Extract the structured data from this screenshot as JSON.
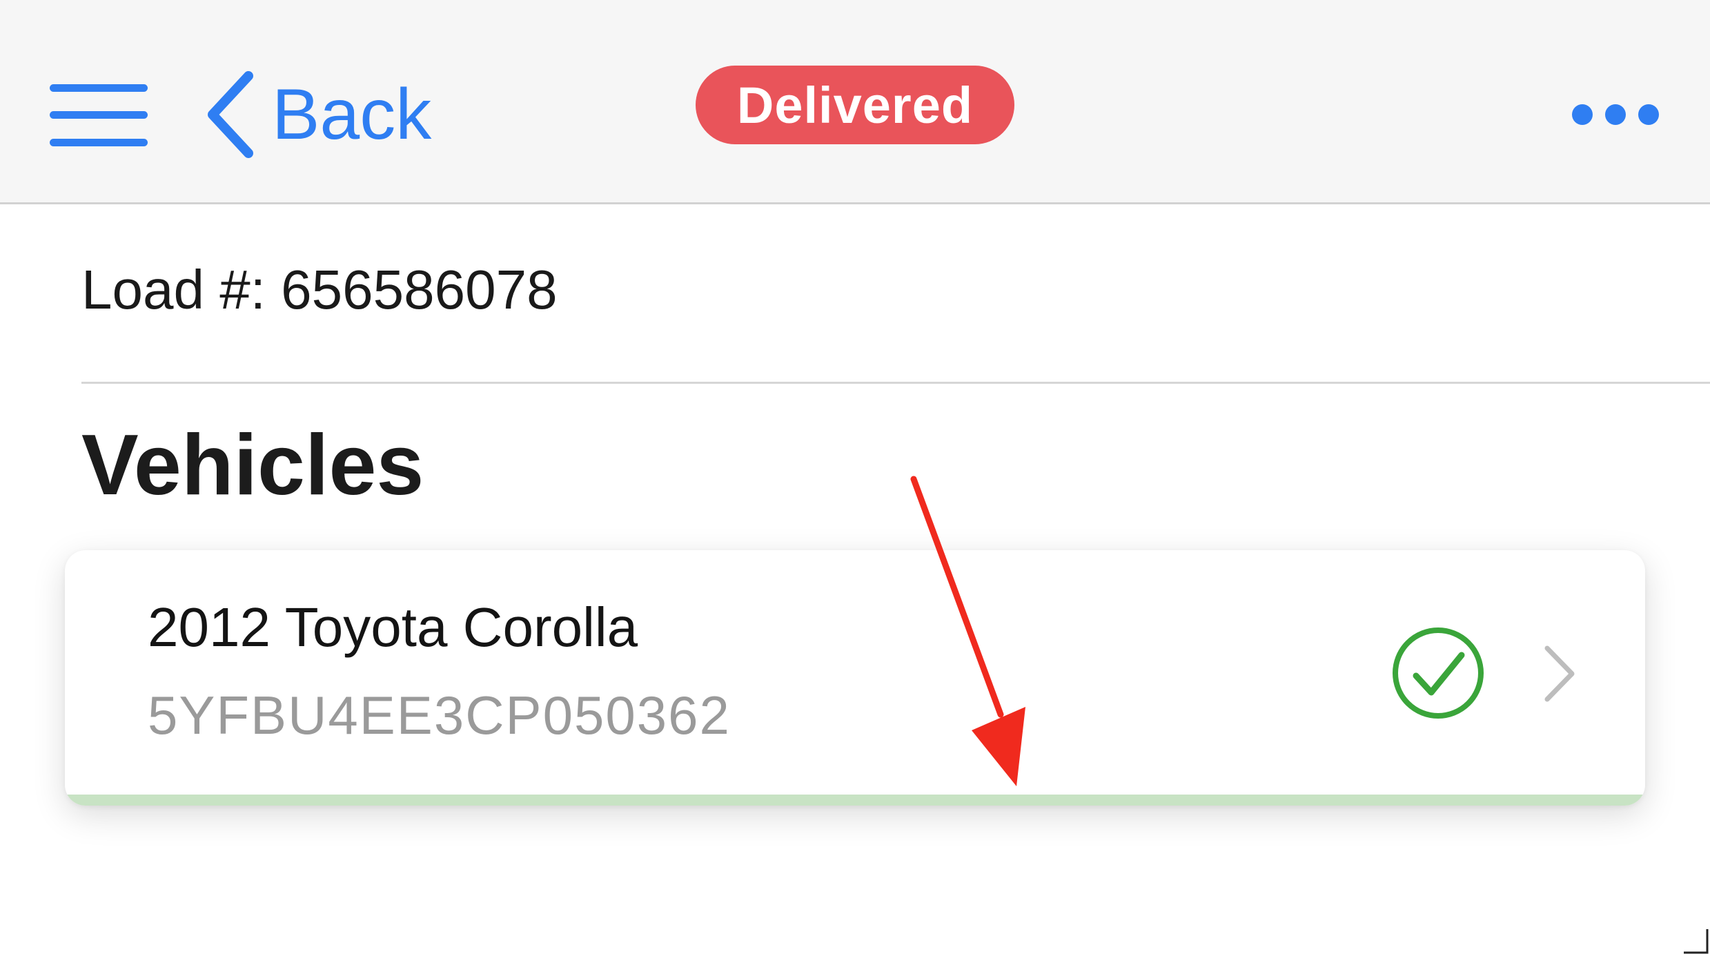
{
  "navbar": {
    "menu_icon": "hamburger-menu-icon",
    "back_label": "Back",
    "back_icon": "chevron-left-icon",
    "status": "Delivered",
    "more_icon": "more-horizontal-icon"
  },
  "load": {
    "label": "Load #: 656586078"
  },
  "vehicles": {
    "title": "Vehicles",
    "items": [
      {
        "name": "2012 Toyota Corolla",
        "vin": "5YFBU4EE3CP050362",
        "status_icon": "check-circle-icon",
        "chevron_icon": "chevron-right-icon",
        "progress_percent": 100
      }
    ]
  },
  "annotation": {
    "icon": "red-arrow-icon"
  },
  "colors": {
    "accent": "#2f7ef2",
    "status_badge": "#e9545a",
    "success": "#3aa53a",
    "progress_fill": "#c8e3c4",
    "annotation": "#f02a1e"
  }
}
